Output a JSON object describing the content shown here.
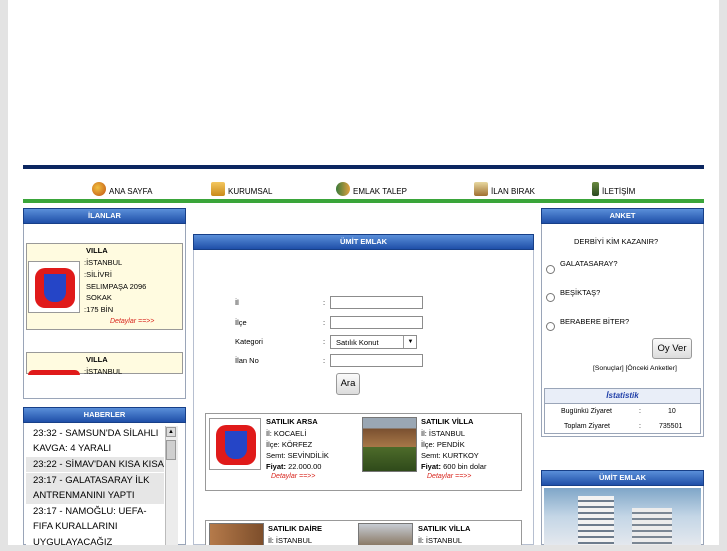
{
  "nav": [
    {
      "label": "ANA SAYFA",
      "icon": "home-icon"
    },
    {
      "label": "KURUMSAL",
      "icon": "folder-icon"
    },
    {
      "label": "EMLAK TALEP",
      "icon": "users-icon"
    },
    {
      "label": "İLAN BIRAK",
      "icon": "clipboard-icon"
    },
    {
      "label": "İLETİŞİM",
      "icon": "phone-icon"
    }
  ],
  "left": {
    "ilanlar_title": "İLANLAR",
    "listing1": {
      "type": "VILLA",
      "city": ":İSTANBUL",
      "district": ":SİLİVRİ",
      "address1": "SELIMPAŞA 2096",
      "address2": "SOKAK",
      "price": ":175 BİN",
      "details": "Detaylar ==>>"
    },
    "listing2": {
      "type": "VILLA",
      "city": ":İSTANBUL"
    },
    "haberler_title": "HABERLER",
    "news": [
      "23:32 - SAMSUN'DA SİLAHLI",
      "KAVGA: 4 YARALI",
      "23:22 - SİMAV'DAN KISA KISA",
      "23:17 - GALATASARAY İLK",
      "ANTRENMANINI YAPTI",
      "23:17 - NAMOĞLU: UEFA-",
      "FIFA KURALLARINI",
      "UYGULAYACAĞIZ"
    ]
  },
  "center": {
    "title": "ÜMİT EMLAK",
    "form": {
      "il_label": "İl",
      "ilce_label": "İlçe",
      "kategori_label": "Kategori",
      "ilanno_label": "İlan No",
      "colon": ":",
      "kategori_value": "Satılık Konut",
      "search_button": "Ara"
    },
    "cards": [
      {
        "title": "SATILIK ARSA",
        "il": "İl: KOCAELİ",
        "ilce": "İlçe: KÖRFEZ",
        "semt": "Semt: SEVİNDİLİK",
        "fiyat_label": "Fiyat:",
        "fiyat": " 22.000.00",
        "details": "Detaylar ==>>"
      },
      {
        "title": "SATILIK VİLLA",
        "il": "İl: İSTANBUL",
        "ilce": "İlçe: PENDİK",
        "semt": "Semt: KURTKOY",
        "fiyat_label": "Fiyat:",
        "fiyat": " 600 bin dolar",
        "details": "Detaylar ==>>"
      },
      {
        "title": "SATILIK DAİRE",
        "il": "İl: İSTANBUL"
      },
      {
        "title": "SATILIK VİLLA",
        "il": "İl: İSTANBUL"
      }
    ]
  },
  "right": {
    "anket_title": "ANKET",
    "question": "DERBİYİ KİM KAZANIR?",
    "options": [
      "GALATASARAY?",
      "BEŞİKTAŞ?",
      "BERABERE BİTER?"
    ],
    "vote_button": "Oy Ver",
    "links": "[Sonuçlar] [Önceki Anketler]",
    "stats_title": "İstatistik",
    "today_label": "Bugünkü Ziyaret",
    "today_value": "10",
    "total_label": "Toplam Ziyaret",
    "total_value": "735501",
    "colon": ":",
    "umit_title": "ÜMİT EMLAK"
  }
}
